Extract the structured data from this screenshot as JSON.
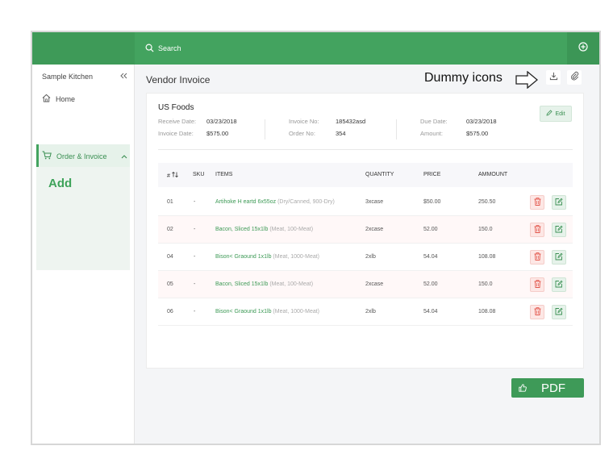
{
  "search": {
    "placeholder": "Search"
  },
  "sidebar": {
    "title": "Sample Kitchen",
    "items": [
      {
        "label": "Home",
        "icon": "home-icon"
      },
      {
        "label": "Order & Invoice",
        "icon": "cart-icon"
      }
    ],
    "sub_label": "Add"
  },
  "page": {
    "title": "Vendor Invoice",
    "annotation": "Dummy icons"
  },
  "invoice": {
    "vendor": "US Foods",
    "edit_label": "Edit",
    "fields": {
      "receive_date_label": "Receive Date:",
      "receive_date": "03/23/2018",
      "invoice_date_label": "Invoice Date:",
      "invoice_date": "$575.00",
      "invoice_no_label": "Invoice No:",
      "invoice_no": "185432asd",
      "order_no_label": "Order No:",
      "order_no": "354",
      "due_date_label": "Due Date:",
      "due_date": "03/23/2018",
      "amount_label": "Amount:",
      "amount": "$575.00"
    }
  },
  "table": {
    "headers": {
      "num": "#",
      "sku": "SKU",
      "items": "ITEMS",
      "quantity": "QUANTITY",
      "price": "PRICE",
      "amount": "AMMOUNT"
    },
    "rows": [
      {
        "num": "01",
        "sku": "-",
        "item": "Artihoke H eartd 6x55oz",
        "desc": "(Dry/Canned, 900-Dry)",
        "qty": "3xcase",
        "price": "$50.00",
        "amount": "250.50"
      },
      {
        "num": "02",
        "sku": "-",
        "item": "Bacon, Sliced 15x1lb",
        "desc": "(Meat, 100-Meat)",
        "qty": "2xcase",
        "price": "52.00",
        "amount": "150.0"
      },
      {
        "num": "04",
        "sku": "-",
        "item": "Bison< Graound 1x1lb",
        "desc": "(Meat, 1000-Meat)",
        "qty": "2xlb",
        "price": "54.04",
        "amount": "108.08"
      },
      {
        "num": "05",
        "sku": "-",
        "item": "Bacon, Sliced 15x1lb",
        "desc": "(Meat, 100-Meat)",
        "qty": "2xcase",
        "price": "52.00",
        "amount": "150.0"
      },
      {
        "num": "06",
        "sku": "-",
        "item": "Bison< Graound 1x1lb",
        "desc": "(Meat, 1000-Meat)",
        "qty": "2xlb",
        "price": "54.04",
        "amount": "108.08"
      }
    ]
  },
  "pdf_button": {
    "label": "PDF"
  },
  "colors": {
    "brand": "#43a35f",
    "danger": "#e2554a",
    "link": "#3d9a56"
  }
}
